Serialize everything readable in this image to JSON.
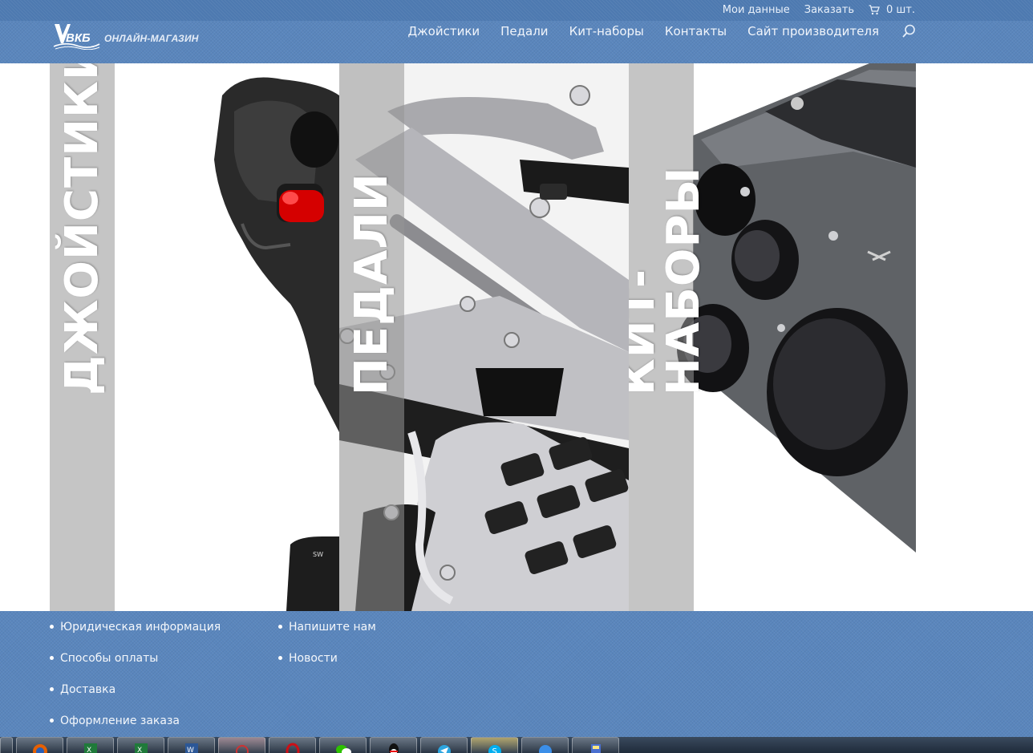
{
  "topbar": {
    "account_label": "Мои данные",
    "order_label": "Заказать",
    "cart_label": "0 шт."
  },
  "logo": {
    "text": "ОНЛАЙН-МАГАЗИН"
  },
  "nav": {
    "items": [
      {
        "label": "Джойстики"
      },
      {
        "label": "Педали"
      },
      {
        "label": "Кит-наборы"
      },
      {
        "label": "Контакты"
      },
      {
        "label": "Сайт производителя"
      }
    ]
  },
  "hero": {
    "panels": [
      {
        "label": "ДЖОЙСТИКИ"
      },
      {
        "label": "ПЕДАЛИ"
      },
      {
        "label": "КИТ-НАБОРЫ"
      }
    ]
  },
  "footer": {
    "col1": [
      {
        "label": "Юридическая информация"
      },
      {
        "label": "Способы оплаты"
      },
      {
        "label": "Доставка"
      },
      {
        "label": "Оформление заказа"
      }
    ],
    "col2": [
      {
        "label": "Напишите нам"
      },
      {
        "label": "Новости"
      }
    ]
  },
  "taskbar": {
    "apps": [
      "firefox-icon",
      "excel-icon",
      "excel-icon",
      "word-icon",
      "app-icon",
      "opera-icon",
      "wechat-icon",
      "qq-icon",
      "telegram-icon",
      "skype-icon",
      "app-icon",
      "app-icon"
    ]
  },
  "colors": {
    "header_blue": "#5a86bd",
    "strip_gray": "#9a9a9a"
  }
}
